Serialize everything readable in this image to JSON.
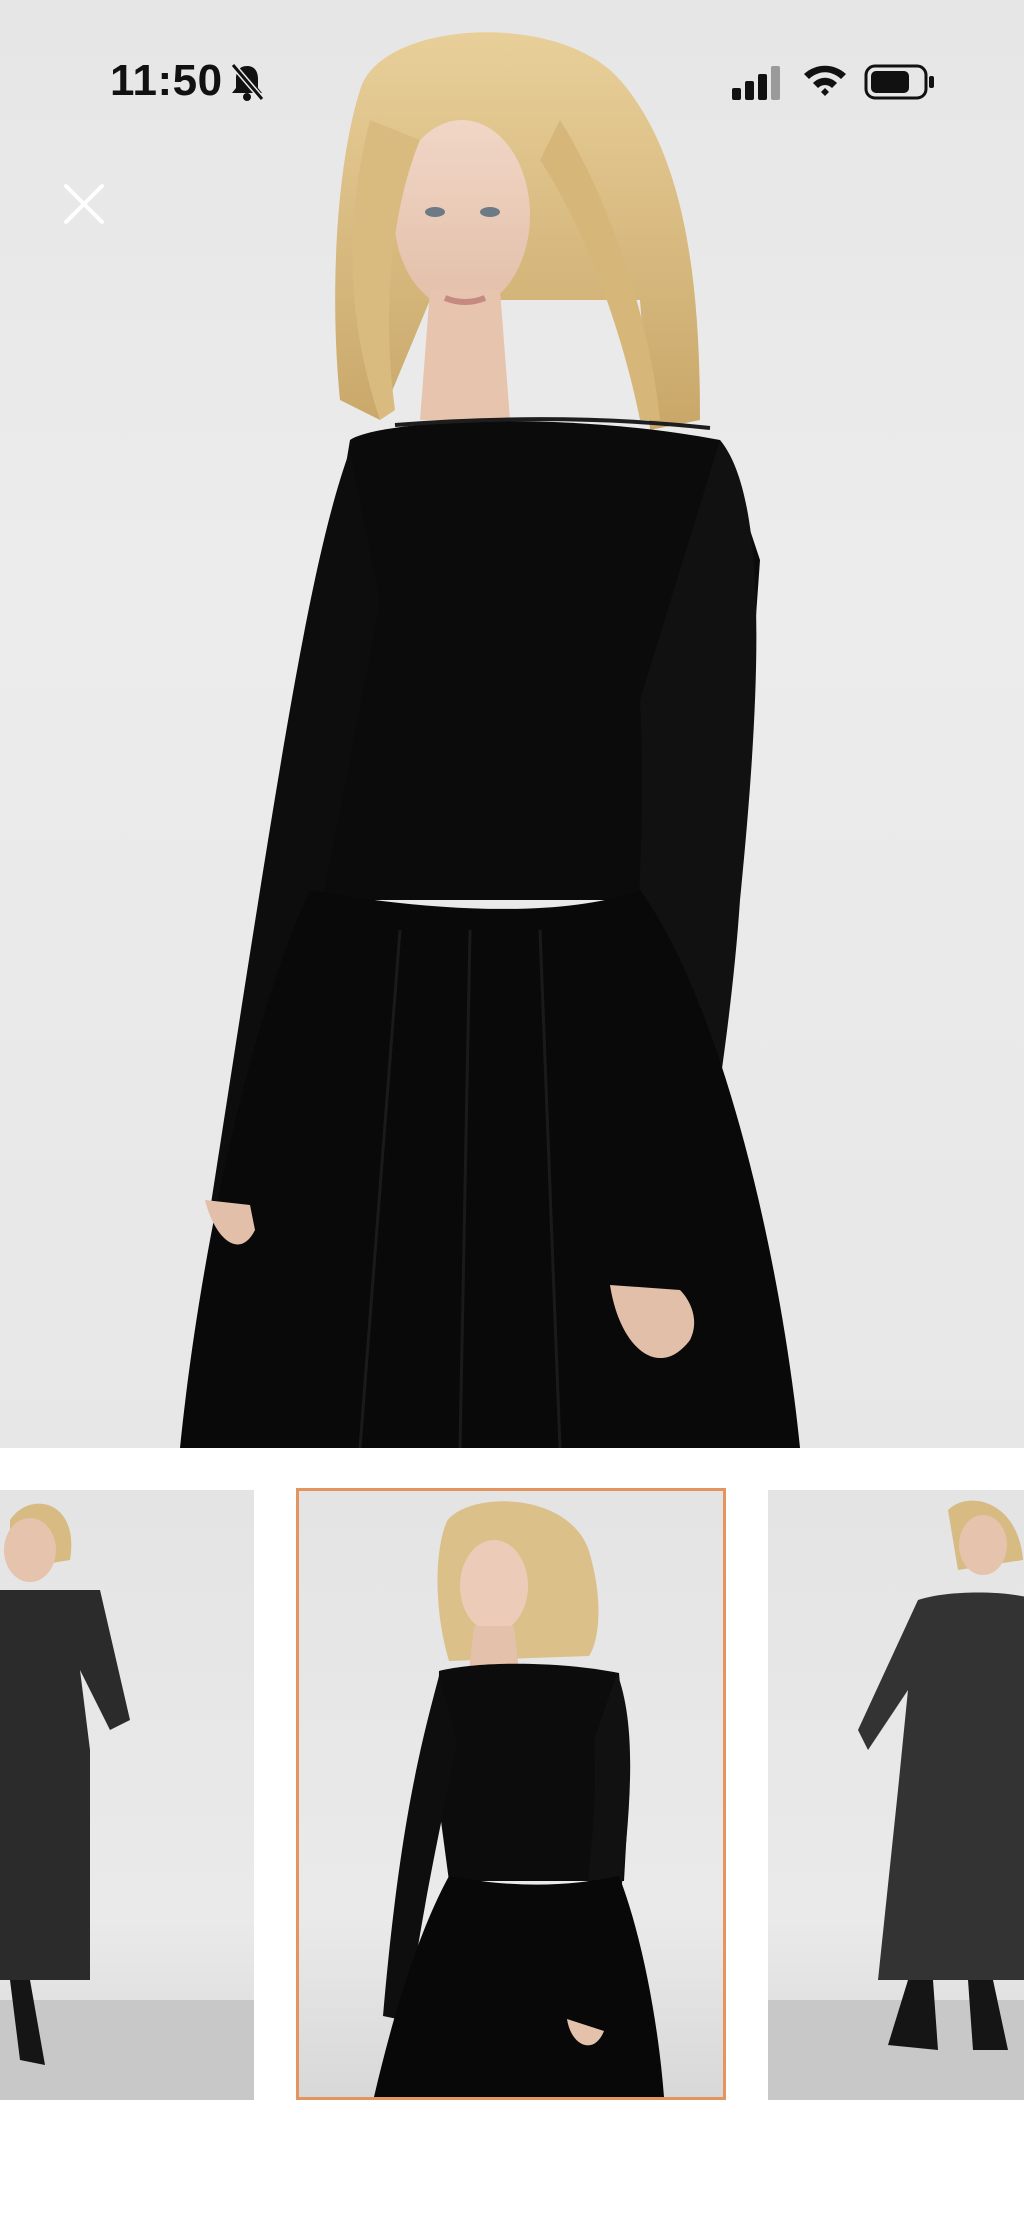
{
  "status_bar": {
    "time": "11:50",
    "icons": [
      "bell-slash-icon",
      "cellular-signal-icon",
      "wifi-icon",
      "battery-icon"
    ]
  },
  "toolbar": {
    "close_icon": "close-icon"
  },
  "gallery": {
    "selected_index": 1,
    "accent_color": "#e2955f",
    "thumbnails": [
      {
        "name": "thumbnail-1",
        "selected": false
      },
      {
        "name": "thumbnail-2",
        "selected": true
      },
      {
        "name": "thumbnail-3",
        "selected": false
      }
    ]
  }
}
